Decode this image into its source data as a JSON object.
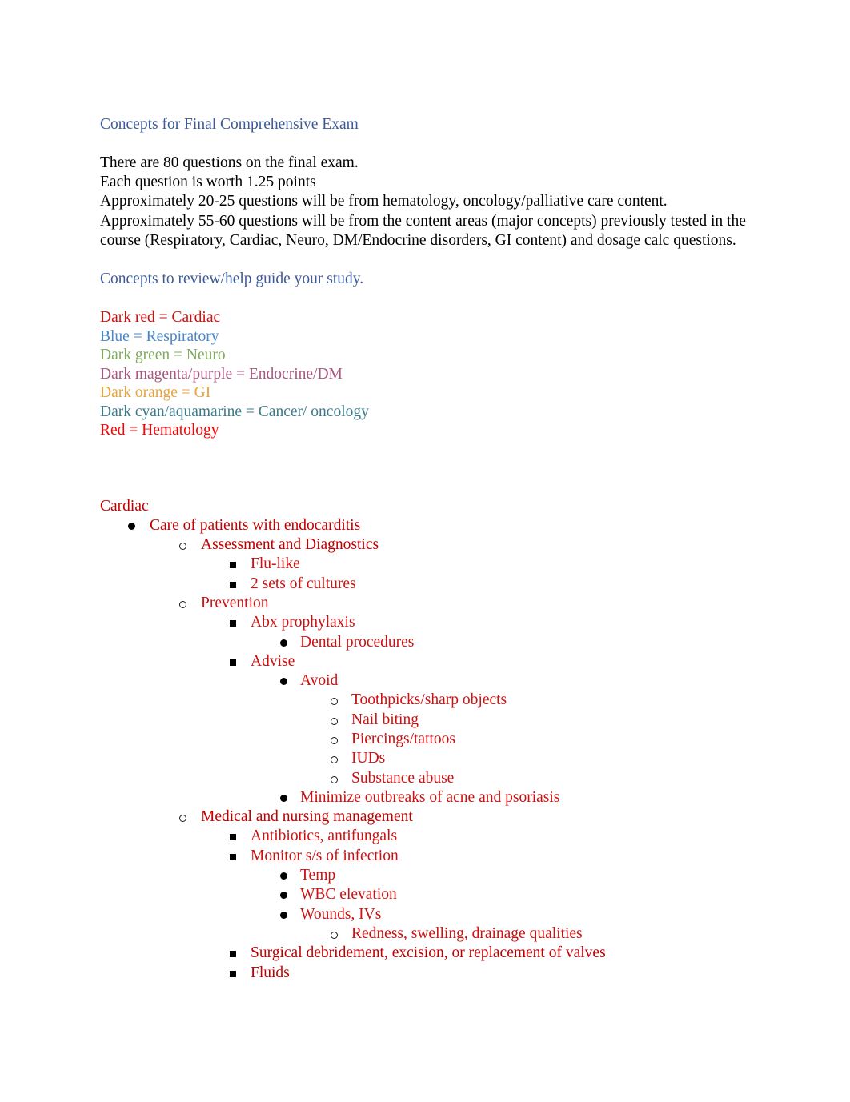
{
  "document": {
    "title": "Concepts for Final Comprehensive Exam",
    "intro_lines": [
      "There are 80 questions on the final exam.",
      "Each question is worth 1.25 points",
      "Approximately 20-25 questions will be from hematology, oncology/palliative care content.",
      "Approximately 55-60 questions will be from the content areas (major concepts) previously tested in the course (Respiratory, Cardiac, Neuro, DM/Endocrine disorders, GI content) and dosage calc questions."
    ],
    "subheading": "Concepts to review/help guide your study.",
    "legend": [
      {
        "text": "Dark red = Cardiac",
        "color": "#cc1111"
      },
      {
        "text": "Blue = Respiratory",
        "color": "#4a86c8"
      },
      {
        "text": "Dark green = Neuro",
        "color": "#7ea95c"
      },
      {
        "text": "Dark magenta/purple = Endocrine/DM",
        "color": "#a8567f"
      },
      {
        "text": "Dark orange = GI",
        "color": "#e8a33d"
      },
      {
        "text": "Dark cyan/aquamarine = Cancer/ oncology",
        "color": "#3d7b8c"
      },
      {
        "text": "Red = Hematology",
        "color": "#ff0000"
      }
    ],
    "sections": [
      {
        "heading": "Cardiac",
        "heading_color": "#c00000",
        "items": [
          {
            "label": "Care of patients with endocarditis",
            "level": 1,
            "bullet": "disc",
            "color": "#c00000",
            "children": [
              {
                "label": "Assessment and Diagnostics",
                "level": 2,
                "bullet": "circ",
                "color": "#c00000",
                "children": [
                  {
                    "label": "Flu-like",
                    "level": 3,
                    "bullet": "sq",
                    "color": "#cc1111",
                    "children": []
                  },
                  {
                    "label": "2 sets of cultures",
                    "level": 3,
                    "bullet": "sq",
                    "color": "#cc1111",
                    "children": []
                  }
                ]
              },
              {
                "label": "Prevention",
                "level": 2,
                "bullet": "circ",
                "color": "#cc1111",
                "children": [
                  {
                    "label": "Abx prophylaxis",
                    "level": 3,
                    "bullet": "sq",
                    "color": "#cc1111",
                    "children": [
                      {
                        "label": "Dental procedures",
                        "level": 4,
                        "bullet": "disc",
                        "color": "#cc1111",
                        "children": []
                      }
                    ]
                  },
                  {
                    "label": "Advise",
                    "level": 3,
                    "bullet": "sq",
                    "color": "#cc1111",
                    "children": [
                      {
                        "label": "Avoid",
                        "level": 4,
                        "bullet": "disc",
                        "color": "#cc1111",
                        "children": [
                          {
                            "label": "Toothpicks/sharp objects",
                            "level": 5,
                            "bullet": "circ",
                            "color": "#cc1111",
                            "children": []
                          },
                          {
                            "label": "Nail biting",
                            "level": 5,
                            "bullet": "circ",
                            "color": "#cc1111",
                            "children": []
                          },
                          {
                            "label": "Piercings/tattoos",
                            "level": 5,
                            "bullet": "circ",
                            "color": "#cc1111",
                            "children": []
                          },
                          {
                            "label": "IUDs",
                            "level": 5,
                            "bullet": "circ",
                            "color": "#cc1111",
                            "children": []
                          },
                          {
                            "label": "Substance abuse",
                            "level": 5,
                            "bullet": "circ",
                            "color": "#cc1111",
                            "children": []
                          }
                        ]
                      },
                      {
                        "label": "Minimize outbreaks of acne and psoriasis",
                        "level": 4,
                        "bullet": "disc",
                        "color": "#cc1111",
                        "children": []
                      }
                    ]
                  }
                ]
              },
              {
                "label": "Medical and nursing management",
                "level": 2,
                "bullet": "circ",
                "color": "#c00000",
                "children": [
                  {
                    "label": "Antibiotics, antifungals",
                    "level": 3,
                    "bullet": "sq",
                    "color": "#cc1111",
                    "children": []
                  },
                  {
                    "label": "Monitor s/s of infection",
                    "level": 3,
                    "bullet": "sq",
                    "color": "#cc1111",
                    "children": [
                      {
                        "label": "Temp",
                        "level": 4,
                        "bullet": "disc",
                        "color": "#cc1111",
                        "children": []
                      },
                      {
                        "label": "WBC elevation",
                        "level": 4,
                        "bullet": "disc",
                        "color": "#cc1111",
                        "children": []
                      },
                      {
                        "label": "Wounds, IVs",
                        "level": 4,
                        "bullet": "disc",
                        "color": "#cc1111",
                        "children": [
                          {
                            "label": "Redness, swelling, drainage qualities",
                            "level": 5,
                            "bullet": "circ",
                            "color": "#cc1111",
                            "children": []
                          }
                        ]
                      }
                    ]
                  },
                  {
                    "label": "Surgical debridement, excision, or replacement of valves",
                    "level": 3,
                    "bullet": "sq",
                    "color": "#c00000",
                    "children": []
                  },
                  {
                    "label": "Fluids",
                    "level": 3,
                    "bullet": "sq",
                    "color": "#c00000",
                    "children": []
                  }
                ]
              }
            ]
          }
        ]
      }
    ]
  }
}
